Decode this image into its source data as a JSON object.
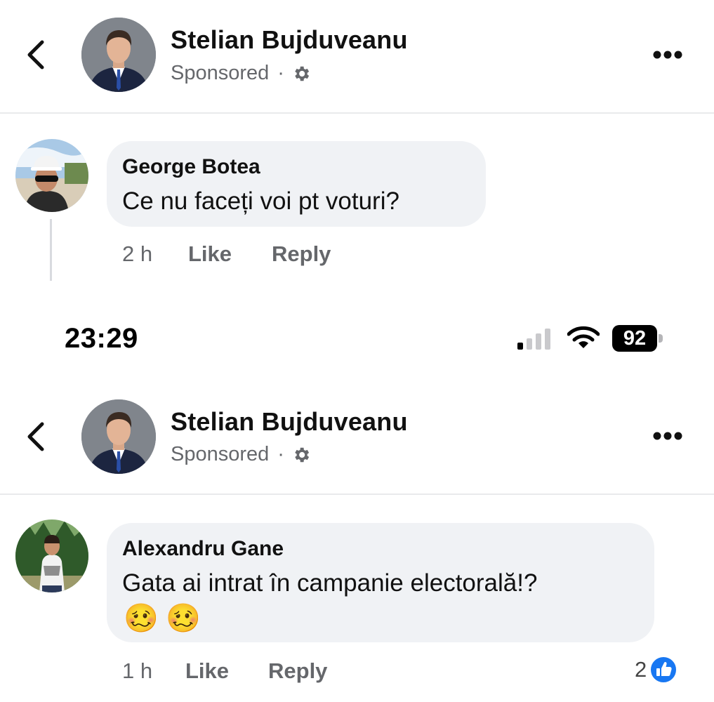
{
  "screen1": {
    "header": {
      "page_name": "Stelian Bujduveanu",
      "sponsored_label": "Sponsored",
      "separator": "·",
      "back_icon": "chevron-left-icon",
      "settings_icon": "gear-icon",
      "more_icon": "more-horizontal-icon"
    },
    "comment": {
      "author": "George Botea",
      "text": "Ce nu faceți voi pt voturi?",
      "time": "2 h",
      "like_label": "Like",
      "reply_label": "Reply"
    }
  },
  "status_bar": {
    "time": "23:29",
    "battery": "92",
    "icons": [
      "cellular-signal-icon",
      "wifi-icon",
      "battery-icon"
    ]
  },
  "screen2": {
    "header": {
      "page_name": "Stelian Bujduveanu",
      "sponsored_label": "Sponsored",
      "separator": "·",
      "back_icon": "chevron-left-icon",
      "settings_icon": "gear-icon",
      "more_icon": "more-horizontal-icon"
    },
    "comment": {
      "author": "Alexandru Gane",
      "text": "Gata ai intrat în campanie electorală!?",
      "emojis": [
        "🥴",
        "🥴"
      ],
      "time": "1 h",
      "like_label": "Like",
      "reply_label": "Reply",
      "reaction_count": "2",
      "reaction_icon": "like-reaction-icon"
    }
  },
  "colors": {
    "text_primary": "#111111",
    "text_secondary": "#65676b",
    "bubble_bg": "#f0f2f5",
    "like_blue": "#1877f2"
  }
}
